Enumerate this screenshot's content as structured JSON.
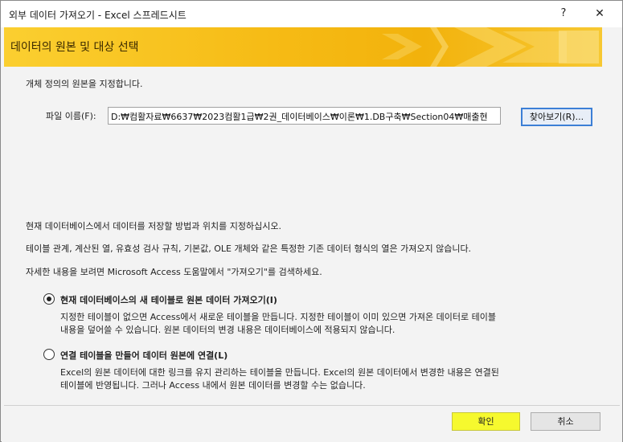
{
  "window": {
    "title": "외부 데이터 가져오기 - Excel 스프레드시트",
    "help": "?",
    "close": "✕"
  },
  "banner": {
    "heading": "데이터의 원본 및 대상 선택",
    "color": "#f6bb15"
  },
  "source": {
    "instruction": "개체 정의의 원본을 지정합니다.",
    "file_label": "파일 이름(F):",
    "file_value": "D:₩컴활자료₩6637₩2023컴활1급₩2권_데이터베이스₩이론₩1.DB구축₩Section04₩매출현",
    "browse_label": "찾아보기(R)..."
  },
  "info": {
    "line1": "현재 데이터베이스에서 데이터를 저장할 방법과 위치를 지정하십시오.",
    "line2": "테이블 관계, 계산된 열, 유효성 검사 규칙, 기본값, OLE 개체와 같은 특정한 기존 데이터 형식의 열은 가져오지 않습니다.",
    "line3": "자세한 내용을 보려면 Microsoft Access 도움말에서 \"가져오기\"를 검색하세요."
  },
  "options": [
    {
      "label": "현재 데이터베이스의 새 테이블로 원본 데이터 가져오기(I)",
      "desc1": "지정한 테이블이 없으면 Access에서 새로운 테이블을 만듭니다. 지정한 테이블이 이미 있으면 가져온 데이터로 테이블",
      "desc2": "내용을 덮어쓸 수 있습니다. 원본 데이터의 변경 내용은 데이터베이스에 적용되지 않습니다.",
      "checked": true
    },
    {
      "label": "연결 테이블을 만들어 데이터 원본에 연결(L)",
      "desc1": "Excel의 원본 데이터에 대한 링크를 유지 관리하는 테이블을 만듭니다. Excel의 원본 데이터에서 변경한 내용은 연결된",
      "desc2": "테이블에 반영됩니다. 그러나 Access 내에서 원본 데이터를 변경할 수는 없습니다.",
      "checked": false
    }
  ],
  "footer": {
    "ok_label": "확인",
    "cancel_label": "취소",
    "ok_highlight": "#f6f92e"
  }
}
